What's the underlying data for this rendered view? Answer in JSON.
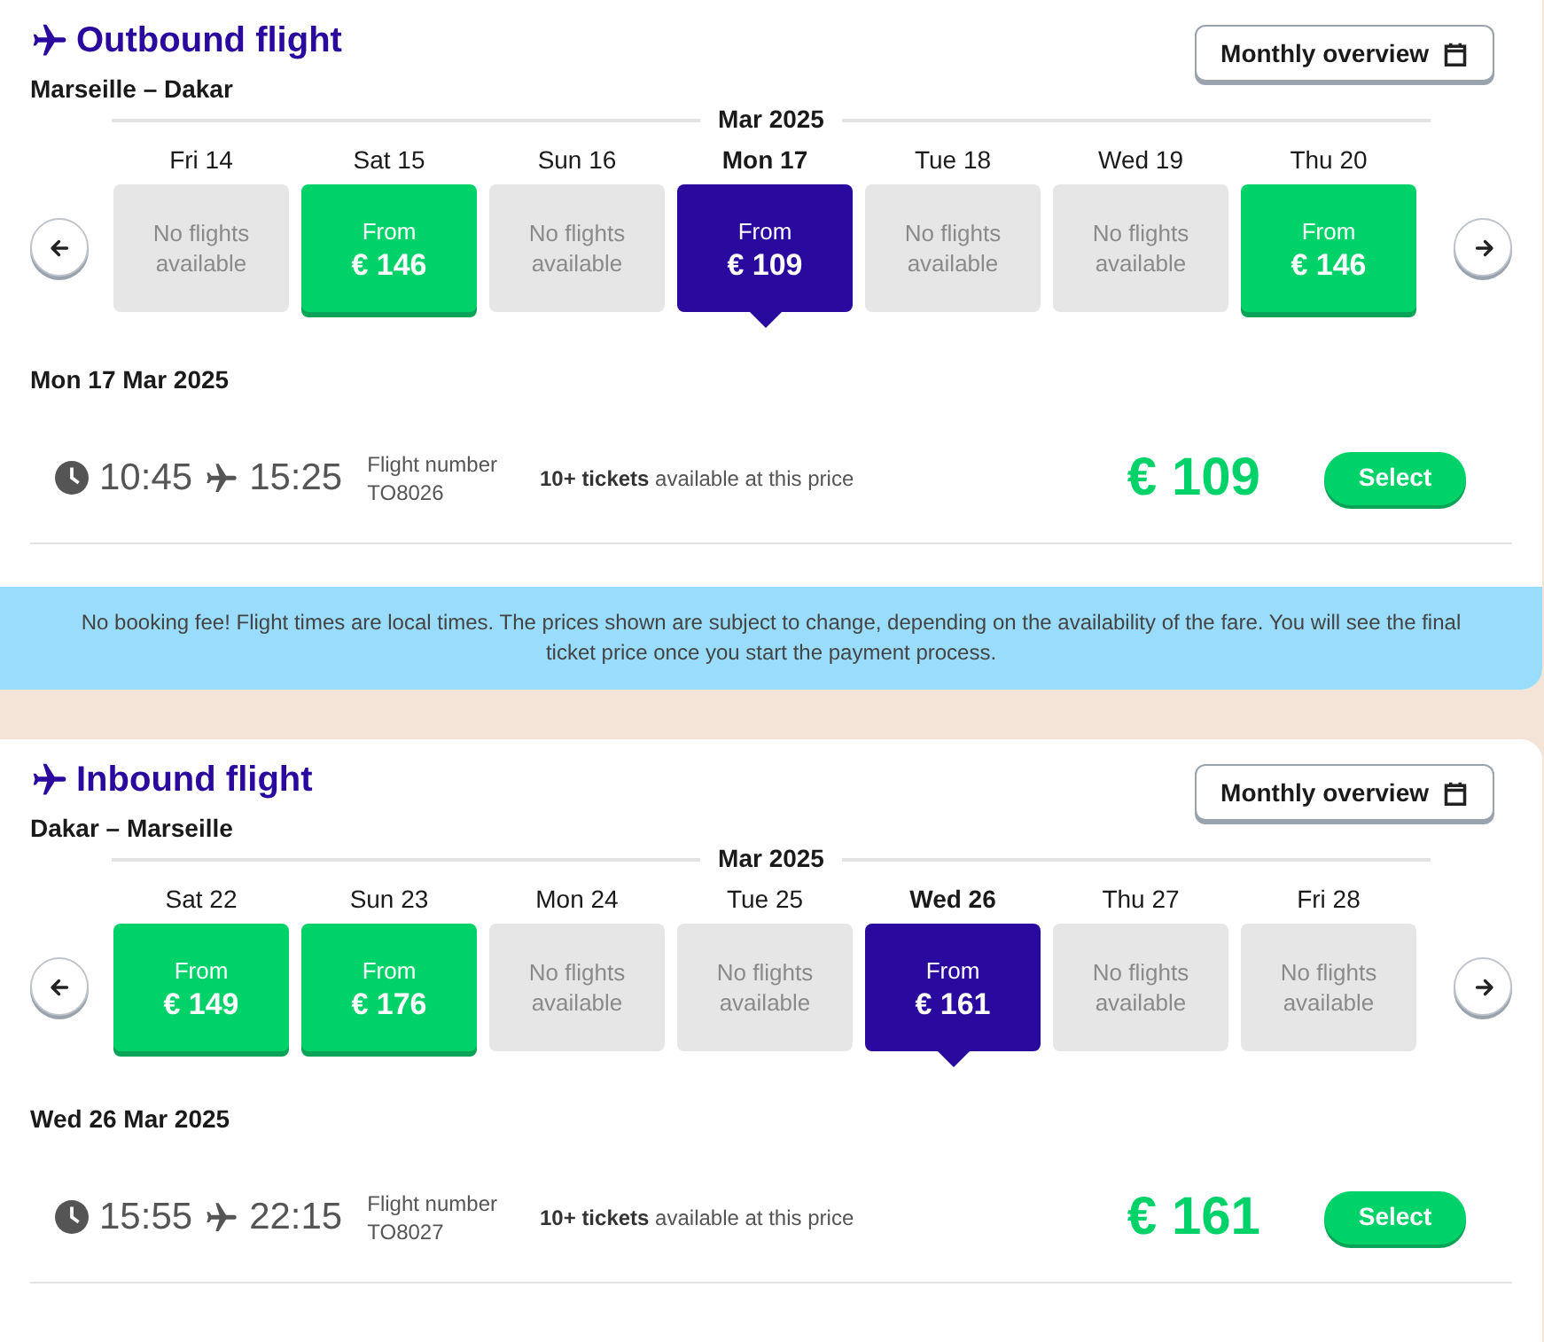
{
  "sections": [
    {
      "title": "Outbound flight",
      "route": "Marseille – Dakar",
      "overview_button": "Monthly overview",
      "month": "Mar 2025",
      "days": [
        {
          "label": "Fri 14",
          "selected": false,
          "kind": "none",
          "text": "No flights available"
        },
        {
          "label": "Sat 15",
          "selected": false,
          "kind": "price",
          "from": "From",
          "price": "€ 146"
        },
        {
          "label": "Sun 16",
          "selected": false,
          "kind": "none",
          "text": "No flights available"
        },
        {
          "label": "Mon 17",
          "selected": true,
          "kind": "price",
          "from": "From",
          "price": "€ 109"
        },
        {
          "label": "Tue 18",
          "selected": false,
          "kind": "none",
          "text": "No flights available"
        },
        {
          "label": "Wed 19",
          "selected": false,
          "kind": "none",
          "text": "No flights available"
        },
        {
          "label": "Thu 20",
          "selected": false,
          "kind": "price",
          "from": "From",
          "price": "€ 146"
        }
      ],
      "date_heading": "Mon 17 Mar 2025",
      "flight": {
        "departure": "10:45",
        "arrival": "15:25",
        "number_label": "Flight number",
        "number": "TO8026",
        "tickets": "**10+ tickets** available at this price",
        "price": "€ 109",
        "select_button": "Select"
      }
    },
    {
      "title": "Inbound flight",
      "route": "Dakar – Marseille",
      "overview_button": "Monthly overview",
      "month": "Mar 2025",
      "days": [
        {
          "label": "Sat 22",
          "selected": false,
          "kind": "price",
          "from": "From",
          "price": "€ 149"
        },
        {
          "label": "Sun 23",
          "selected": false,
          "kind": "price",
          "from": "From",
          "price": "€ 176"
        },
        {
          "label": "Mon 24",
          "selected": false,
          "kind": "none",
          "text": "No flights available"
        },
        {
          "label": "Tue 25",
          "selected": false,
          "kind": "none",
          "text": "No flights available"
        },
        {
          "label": "Wed 26",
          "selected": true,
          "kind": "price",
          "from": "From",
          "price": "€ 161"
        },
        {
          "label": "Thu 27",
          "selected": false,
          "kind": "none",
          "text": "No flights available"
        },
        {
          "label": "Fri 28",
          "selected": false,
          "kind": "none",
          "text": "No flights available"
        }
      ],
      "date_heading": "Wed 26 Mar 2025",
      "flight": {
        "departure": "15:55",
        "arrival": "22:15",
        "number_label": "Flight number",
        "number": "TO8027",
        "tickets": "**10+ tickets** available at this price",
        "price": "€ 161",
        "select_button": "Select"
      }
    }
  ],
  "notice": "No booking fee! Flight times are local times. The prices shown are subject to change, depending on the availability of the fare. You will see the final ticket price once you start the payment process."
}
